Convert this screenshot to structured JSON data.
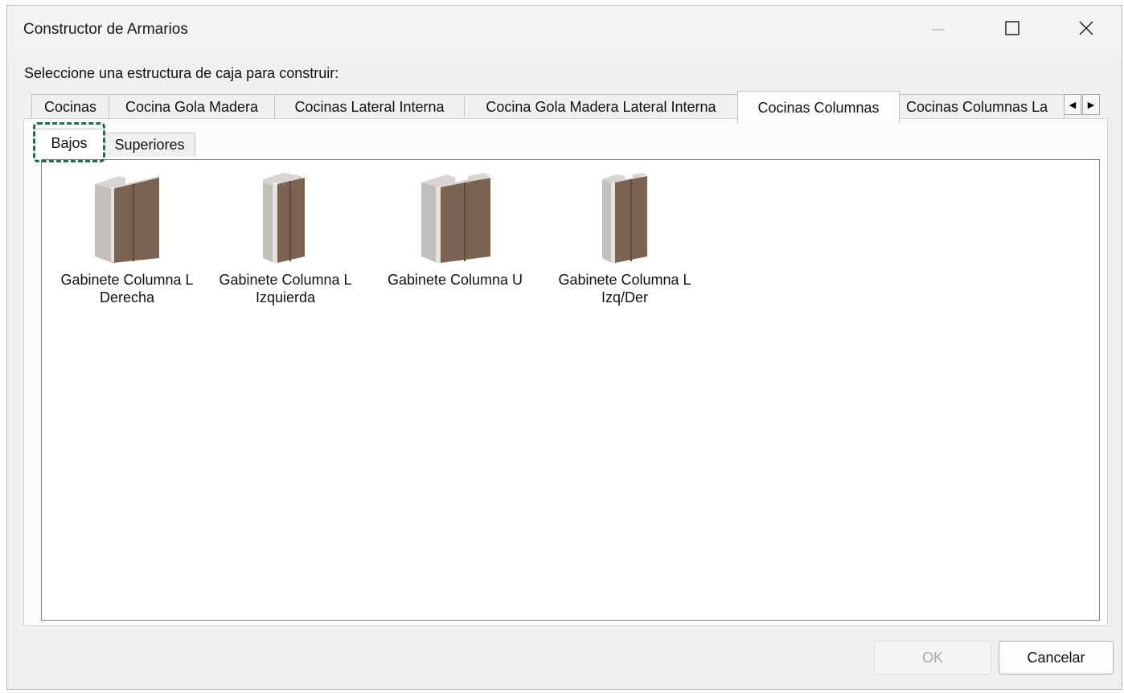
{
  "window": {
    "title": "Constructor de Armarios"
  },
  "instruction": "Seleccione una estructura de caja para construir:",
  "tabs": [
    {
      "label": "Cocinas"
    },
    {
      "label": "Cocina Gola Madera"
    },
    {
      "label": "Cocinas Lateral Interna"
    },
    {
      "label": "Cocina Gola Madera Lateral Interna"
    },
    {
      "label": "Cocinas Columnas",
      "active": true
    },
    {
      "label": "Cocinas Columnas La"
    }
  ],
  "subtabs": [
    {
      "label": "Bajos",
      "active": true
    },
    {
      "label": "Superiores"
    }
  ],
  "items": [
    {
      "line1": "Gabinete Columna L",
      "line2": "Derecha",
      "icon": "cabinet-l-right-icon"
    },
    {
      "line1": "Gabinete Columna L",
      "line2": "Izquierda",
      "icon": "cabinet-l-left-icon"
    },
    {
      "line1": "Gabinete Columna U",
      "line2": "",
      "icon": "cabinet-u-icon"
    },
    {
      "line1": "Gabinete Columna L",
      "line2": "Izq/Der",
      "icon": "cabinet-l-both-icon"
    }
  ],
  "buttons": {
    "ok": "OK",
    "cancel": "Cancelar"
  },
  "colors": {
    "accent_highlight": "#1a6b58",
    "wood": "#7a6350",
    "panel": "#c8c4bf"
  }
}
